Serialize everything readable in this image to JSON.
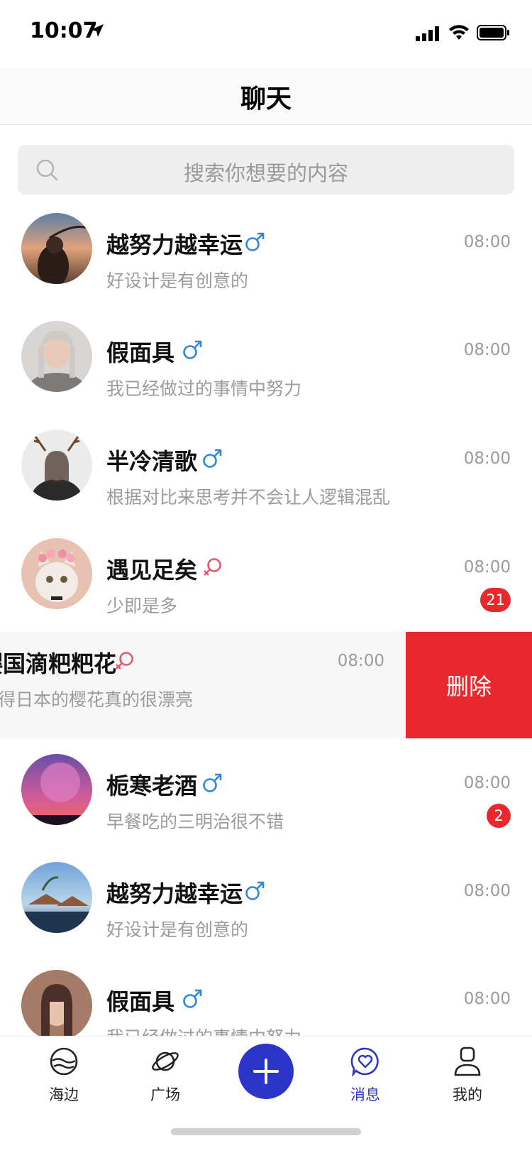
{
  "status_bar": {
    "time": "10:07"
  },
  "header": {
    "title": "聊天"
  },
  "search": {
    "placeholder": "搜索你想要的内容"
  },
  "chats": [
    {
      "name": "越努力越幸运",
      "gender": "male",
      "preview": "好设计是有创意的",
      "time": "08:00",
      "badge": ""
    },
    {
      "name": "假面具",
      "gender": "male",
      "preview": "我已经做过的事情中努力",
      "time": "08:00",
      "badge": ""
    },
    {
      "name": "半冷清歌",
      "gender": "male",
      "preview": "根据对比来思考并不会让人逻辑混乱",
      "time": "08:00",
      "badge": ""
    },
    {
      "name": "遇见足矣",
      "gender": "female",
      "preview": "少即是多",
      "time": "08:00",
      "badge": "21"
    },
    {
      "name": "樱国滴粑粑花",
      "gender": "female",
      "preview": "觉得日本的樱花真的很漂亮",
      "time": "08:00",
      "badge": ""
    },
    {
      "name": "栀寒老酒",
      "gender": "male",
      "preview": "早餐吃的三明治很不错",
      "time": "08:00",
      "badge": "2"
    },
    {
      "name": "越努力越幸运",
      "gender": "male",
      "preview": "好设计是有创意的",
      "time": "08:00",
      "badge": ""
    },
    {
      "name": "假面具",
      "gender": "male",
      "preview": "我已经做过的事情中努力",
      "time": "08:00",
      "badge": ""
    }
  ],
  "swipe_action": {
    "delete_label": "删除"
  },
  "tabs": [
    {
      "label": "海边",
      "icon": "beach-icon"
    },
    {
      "label": "广场",
      "icon": "planet-icon"
    },
    {
      "label": "消息",
      "icon": "message-heart-icon"
    },
    {
      "label": "我的",
      "icon": "profile-icon"
    }
  ],
  "colors": {
    "accent": "#2b36c9",
    "male": "#2f86d8",
    "female": "#e7566b",
    "badge": "#e8282c",
    "delete": "#e8282c"
  }
}
